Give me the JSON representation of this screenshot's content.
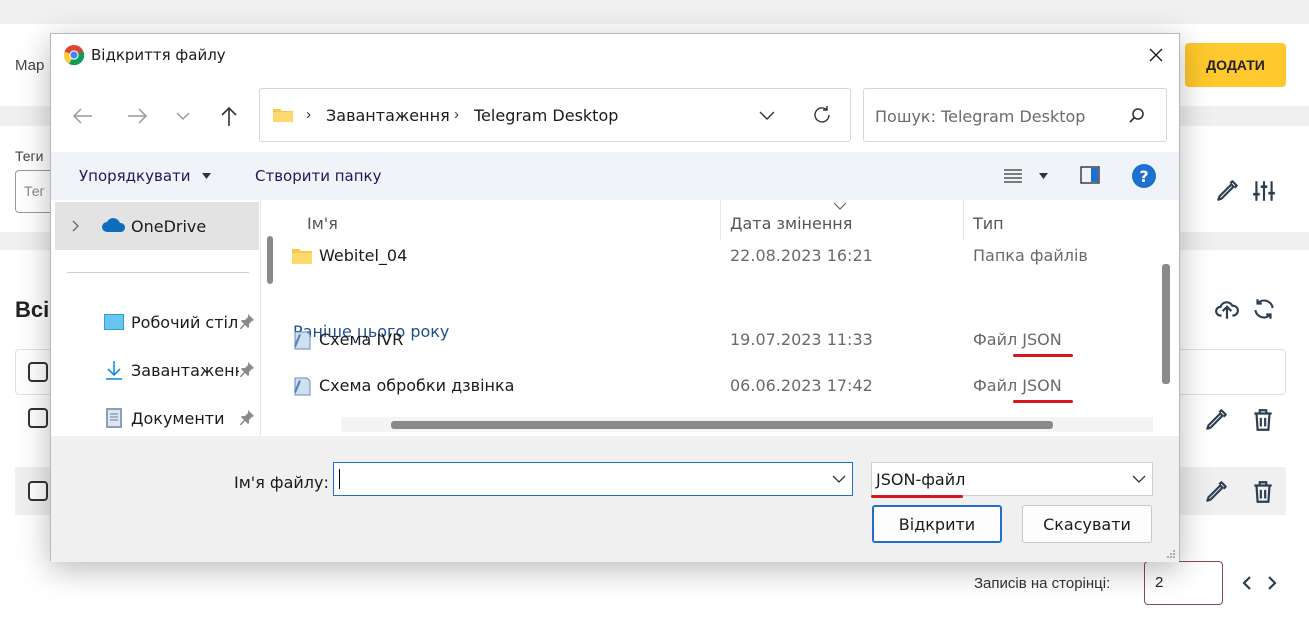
{
  "background": {
    "top_label": "Мар",
    "add_button": "ДОДАТИ",
    "tags_label": "Теги",
    "tags_placeholder": "Тег",
    "section_title": "Всі",
    "pager_label": "Записів на сторінці:",
    "pager_value": "2"
  },
  "dialog": {
    "title": "Відкриття файлу",
    "address": {
      "segments": [
        "Завантаження",
        "Telegram Desktop"
      ]
    },
    "search_placeholder": "Пошук: Telegram Desktop",
    "toolbar": {
      "organize": "Упорядкувати",
      "new_folder": "Створити папку"
    },
    "nav": [
      {
        "label": "OneDrive",
        "icon": "cloud-icon"
      },
      {
        "label": "Робочий стіл",
        "icon": "desktop-icon"
      },
      {
        "label": "Завантаження",
        "icon": "download-icon"
      },
      {
        "label": "Документи",
        "icon": "document-icon"
      }
    ],
    "columns": {
      "name": "Ім'я",
      "date": "Дата змінення",
      "type": "Тип"
    },
    "group_label": "Раніше цього року",
    "files": [
      {
        "name": "Webitel_04",
        "date": "22.08.2023 16:21",
        "type": "Папка файлів"
      },
      {
        "name": "Схема IVR",
        "date": "19.07.2023 11:33",
        "type": "Файл JSON"
      },
      {
        "name": "Схема обробки дзвінка",
        "date": "06.06.2023 17:42",
        "type": "Файл JSON"
      }
    ],
    "filename_label": "Ім'я файлу:",
    "filename_value": "",
    "filter_value": "JSON-файл",
    "open_button": "Відкрити",
    "cancel_button": "Скасувати",
    "accent": "#1f6fd0",
    "highlight": "#d8161b"
  }
}
